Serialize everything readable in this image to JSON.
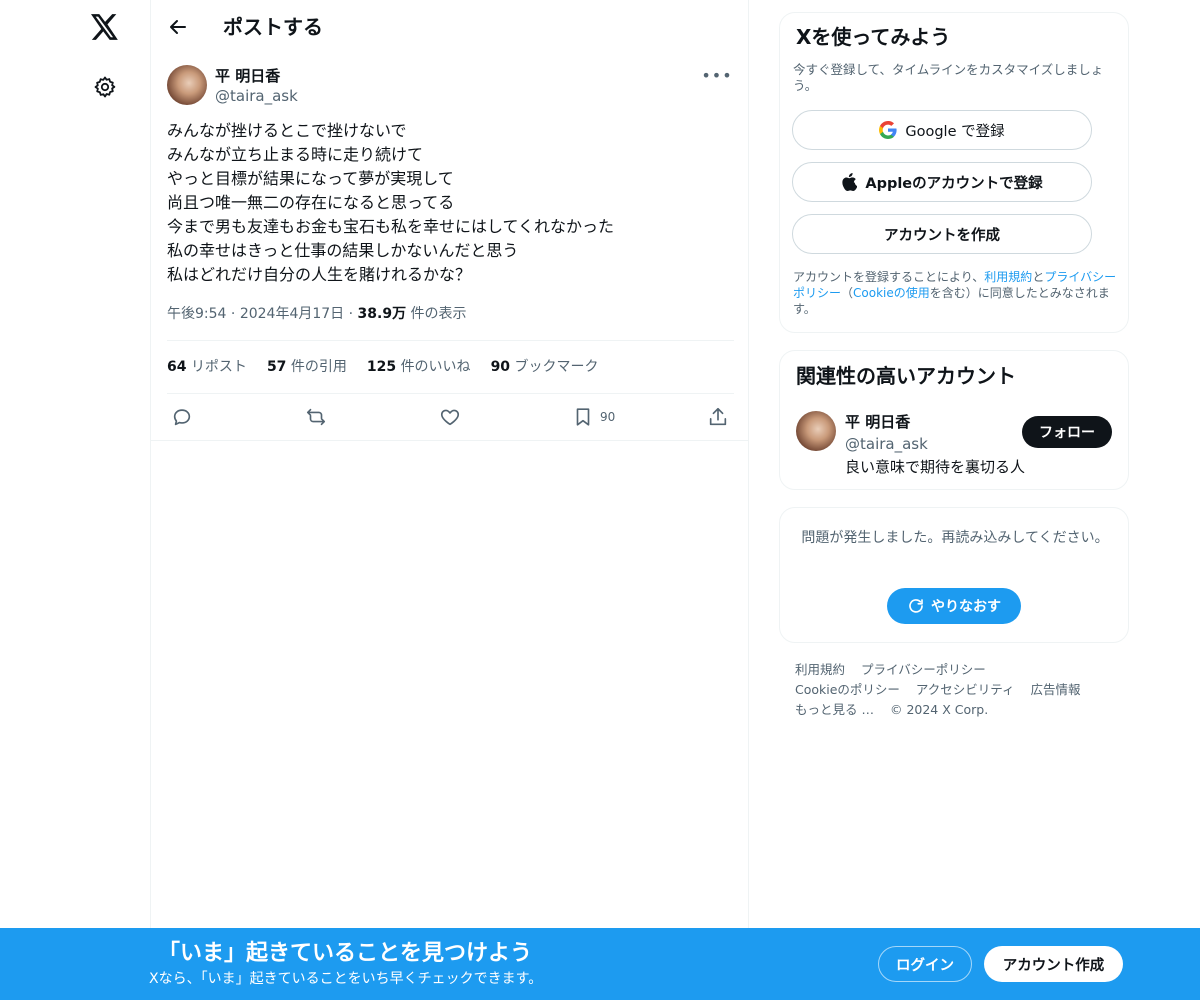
{
  "nav": {
    "logo_icon": "x-logo-icon",
    "settings_icon": "gear-icon"
  },
  "header": {
    "title": "ポストする"
  },
  "post": {
    "author_name": "平 明日香",
    "author_handle": "@taira_ask",
    "lines": [
      "みんなが挫けるとこで挫けないで",
      "みんなが立ち止まる時に走り続けて",
      "やっと目標が結果になって夢が実現して",
      "尚且つ唯一無二の存在になると思ってる",
      "今まで男も友達もお金も宝石も私を幸せにはしてくれなかった",
      "私の幸せはきっと仕事の結果しかないんだと思う",
      "私はどれだけ自分の人生を賭けれるかな？"
    ],
    "time": "午後9:54",
    "date": "2024年4月17日",
    "views_count": "38.9万",
    "views_label": "件の表示",
    "sep": "·"
  },
  "stats": {
    "reposts_count": "64",
    "reposts_label": "リポスト",
    "quotes_count": "57",
    "quotes_label": "件の引用",
    "likes_count": "125",
    "likes_label": "件のいいね",
    "bookmarks_count": "90",
    "bookmarks_label": "ブックマーク"
  },
  "actions": {
    "bookmark_count": "90"
  },
  "signup_card": {
    "title": "Xを使ってみよう",
    "subtitle": "今すぐ登録して、タイムラインをカスタマイズしましょう。",
    "google_label": "Google で登録",
    "apple_label": "Appleのアカウントで登録",
    "create_label": "アカウントを作成",
    "terms_prefix": "アカウントを登録することにより、",
    "terms_link": "利用規約",
    "terms_and": "と",
    "privacy_link": "プライバシーポリシー",
    "cookie_open": "（",
    "cookie_link": "Cookieの使用",
    "cookie_close": "を含む）に同意したとみなされます。"
  },
  "related_card": {
    "title": "関連性の高いアカウント",
    "name": "平 明日香",
    "handle": "@taira_ask",
    "bio": "良い意味で期待を裏切る人",
    "follow_label": "フォロー"
  },
  "error_card": {
    "message": "問題が発生しました。再読み込みしてください。",
    "retry_label": "やりなおす"
  },
  "footer": {
    "links": [
      "利用規約",
      "プライバシーポリシー",
      "Cookieのポリシー",
      "アクセシビリティ",
      "広告情報",
      "もっと見る …",
      "© 2024 X Corp."
    ]
  },
  "bottom_bar": {
    "title": "「いま」起きていることを見つけよう",
    "subtitle": "Xなら、「いま」起きていることをいち早くチェックできます。",
    "login_label": "ログイン",
    "signup_label": "アカウント作成"
  },
  "colors": {
    "accent": "#1d9bf0",
    "text": "#0f1419",
    "muted": "#536471",
    "border": "#eff3f4"
  }
}
